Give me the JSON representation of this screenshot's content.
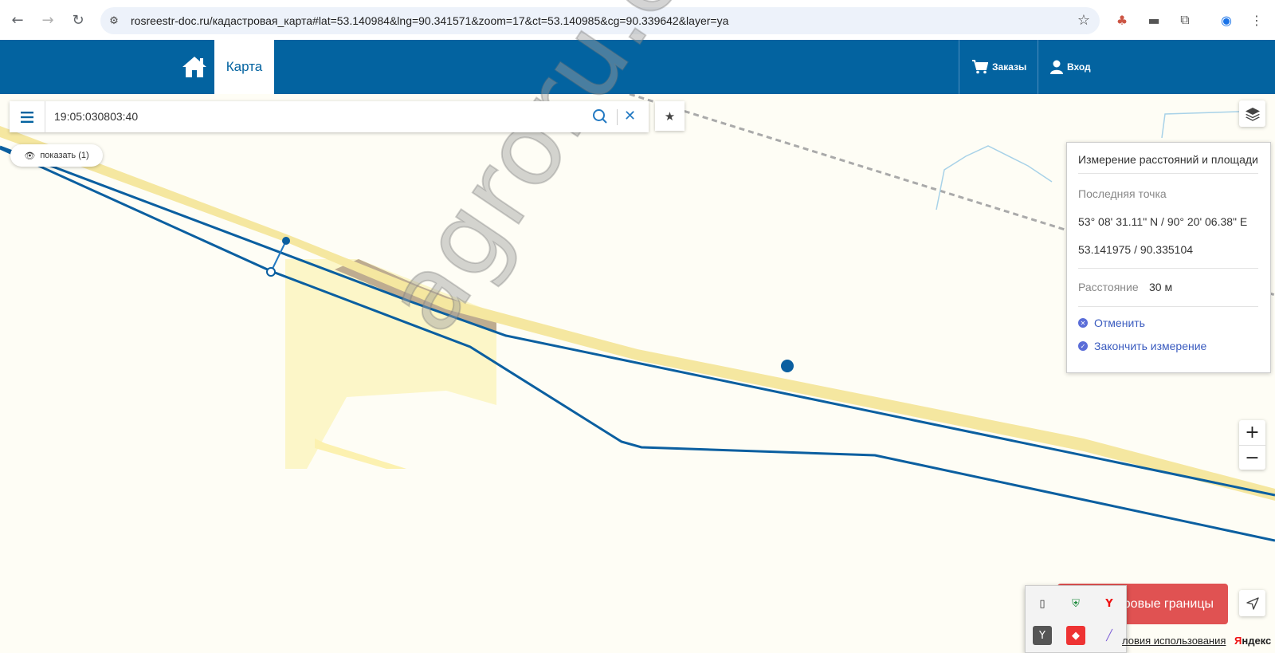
{
  "browser": {
    "url": "rosreestr-doc.ru/кадастровая_карта#lat=53.140984&lng=90.341571&zoom=17&ct=53.140985&cg=90.339642&layer=ya",
    "back_icon": "arrow-left-icon",
    "forward_icon": "arrow-right-icon",
    "reload_icon": "reload-icon"
  },
  "header": {
    "tab_map": "Карта",
    "orders": "Заказы",
    "login": "Вход",
    "color": "#0363a0"
  },
  "search": {
    "query": "19:05:030803:40"
  },
  "show_pill": {
    "label": "показать (1)"
  },
  "watermark": "agroru.com",
  "measure_panel": {
    "title": "Измерение расстояний и площади",
    "last_point_label": "Последняя точка",
    "coords_dms": "53° 08' 31.11\" N / 90° 20' 06.38\" E",
    "coords_decimal": "53.141975 / 90.335104",
    "distance_label": "Расстояние",
    "distance_value": "30 м",
    "cancel": "Отменить",
    "finish": "Закончить измерение"
  },
  "zoom": {
    "plus": "+",
    "minus": "−"
  },
  "red_button": "тровые границы",
  "footer": {
    "terms": "ловия использования",
    "yandex_first": "Я",
    "yandex_rest": "ндекс"
  },
  "colors": {
    "parcel_line": "#0b5fa0",
    "parcel_fill": "#fcf6c8",
    "road": "#f6e8a0",
    "accent_red": "#e05252"
  }
}
